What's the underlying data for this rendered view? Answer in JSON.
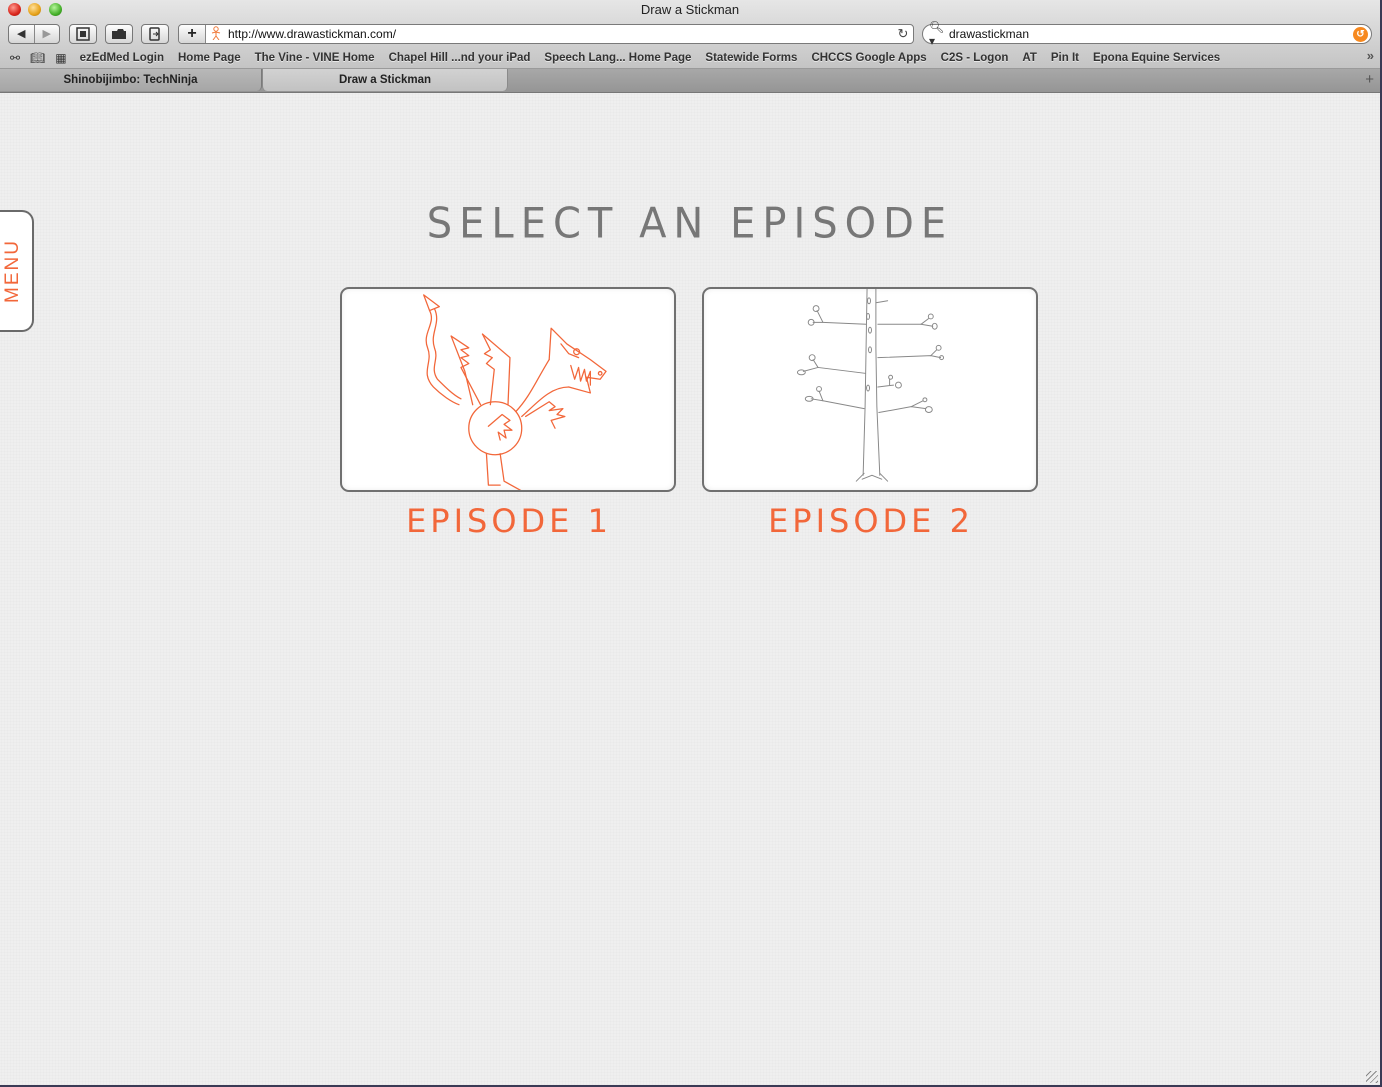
{
  "window": {
    "title": "Draw a Stickman"
  },
  "toolbar": {
    "back_icon": "◀",
    "forward_icon": "▶",
    "add_bookmark": "+",
    "url": "http://www.drawastickman.com/",
    "reload_icon": "↻",
    "search_value": "drawastickman",
    "search_icon": "🔍︎▾",
    "snapback_icon": "↺"
  },
  "bookmarks_bar": {
    "items": [
      "ezEdMed Login",
      "Home Page",
      "The Vine - VINE Home",
      "Chapel Hill ...nd your iPad",
      "Speech Lang... Home Page",
      "Statewide Forms",
      "CHCCS Google Apps",
      "C2S - Logon",
      "AT",
      "Pin It",
      "Epona Equine Services"
    ],
    "more_icon": "»"
  },
  "tabs": [
    {
      "label": "Shinobijimbo: TechNinja",
      "active": false
    },
    {
      "label": "Draw a Stickman",
      "active": true
    }
  ],
  "new_tab_icon": "+",
  "page": {
    "menu_label": "MENU",
    "heading": "SELECT AN EPISODE",
    "episodes": [
      {
        "label": "EPISODE 1",
        "thumbnail": "dragon drawing (orange)"
      },
      {
        "label": "EPISODE 2",
        "thumbnail": "bare tree drawing (gray)"
      }
    ],
    "accent_color": "#f2673a"
  }
}
